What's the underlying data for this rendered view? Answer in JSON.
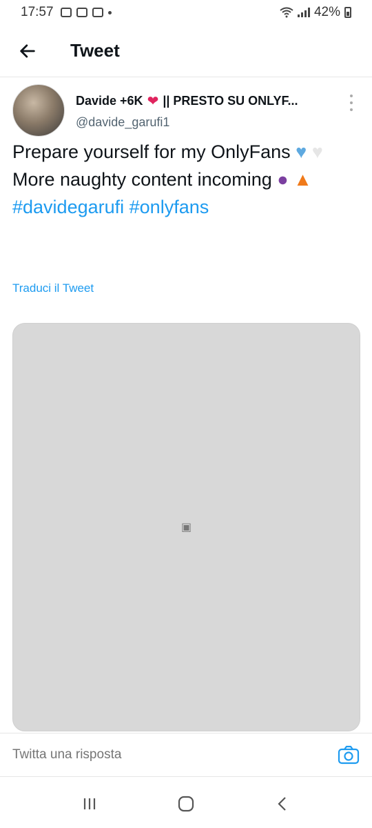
{
  "status_bar": {
    "time": "17:57",
    "battery": "42%"
  },
  "header": {
    "title": "Tweet",
    "back_icon": "arrow-left-icon"
  },
  "tweet": {
    "display_name": "Davide +6K",
    "display_name_suffix": "|| PRESTO SU ONLYF...",
    "handle": "@davide_garufi1",
    "line1": "Prepare yourself for my OnlyFans",
    "line2": "More naughty content incoming",
    "hashtag1": "#davidegarufi",
    "hashtag2": "#onlyfans",
    "translate": "Traduci il Tweet"
  },
  "reply": {
    "placeholder": "Twitta una risposta"
  },
  "colors": {
    "link": "#1d9bf0",
    "text": "#0f1419",
    "muted": "#536471"
  }
}
